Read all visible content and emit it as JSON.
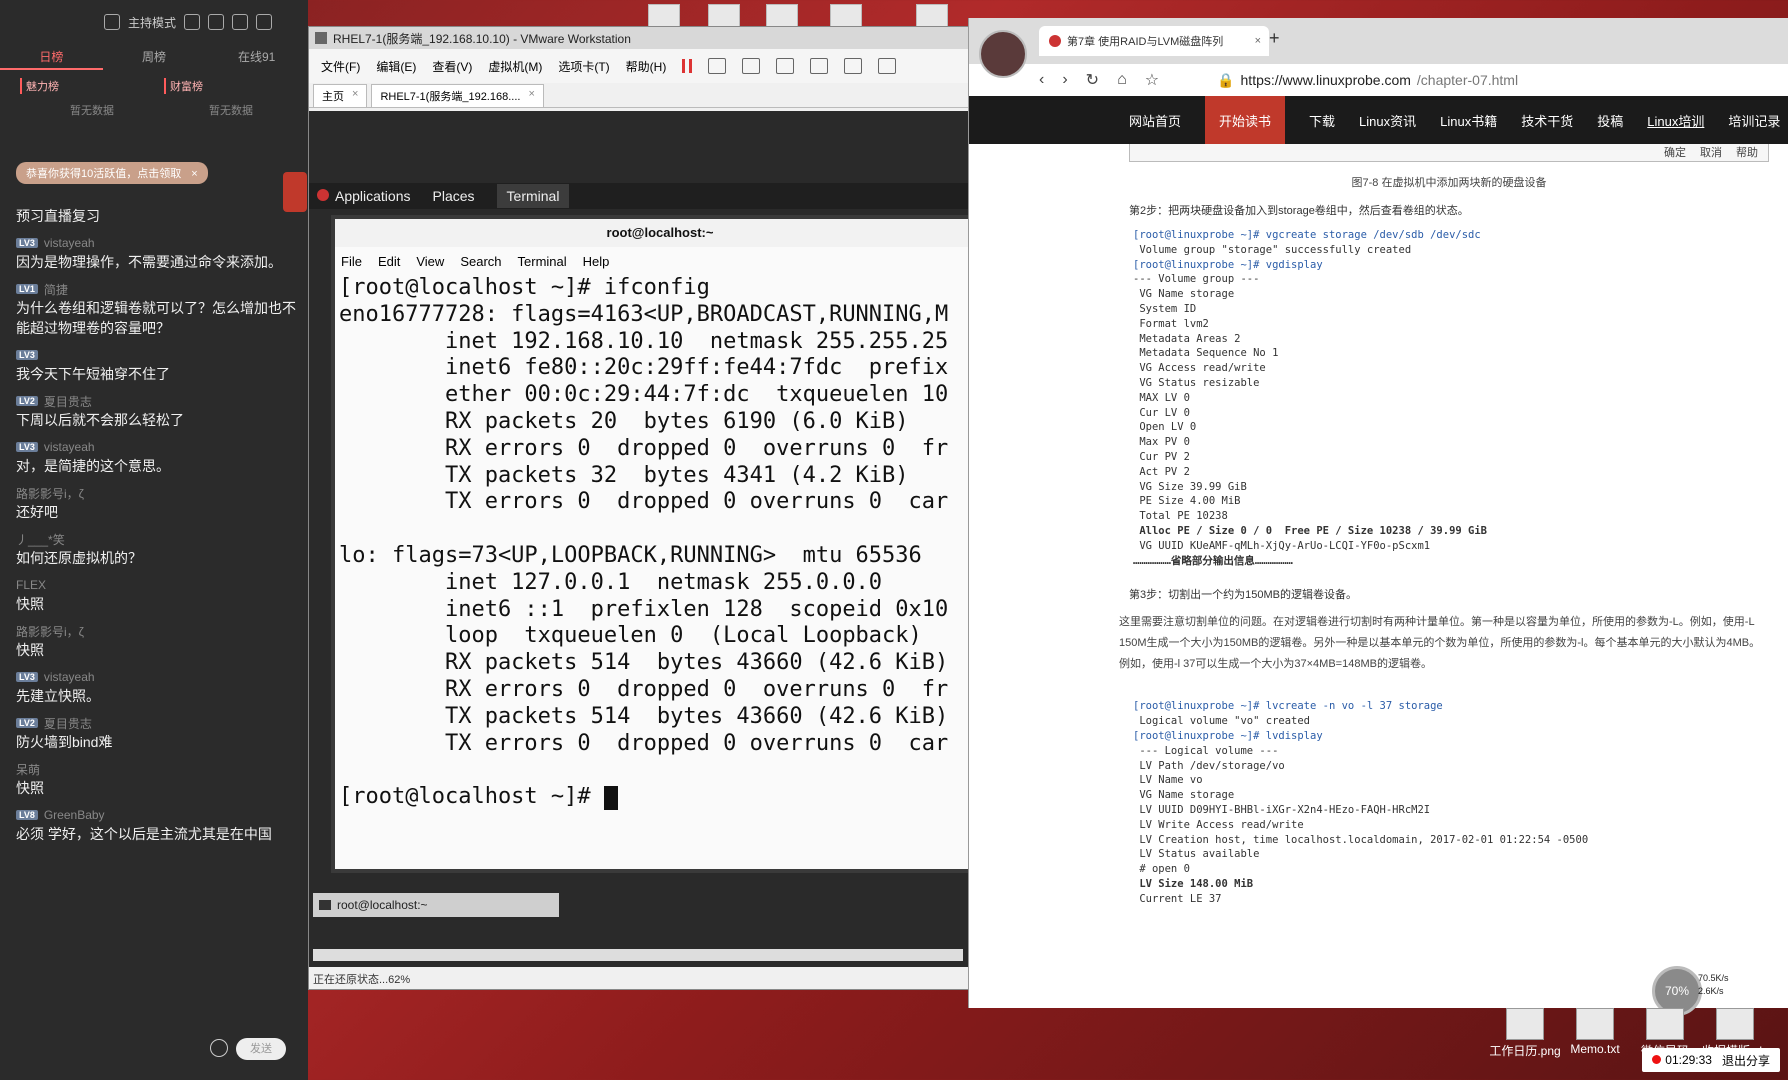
{
  "chat": {
    "mode_label": "主持模式",
    "tabs": [
      "日榜",
      "周榜",
      "在线91"
    ],
    "rank_left": "魅力榜",
    "rank_right": "财富榜",
    "no_data_left": "暂无数据",
    "no_data_right": "暂无数据",
    "banner": "恭喜你获得10活跃值，点击领取",
    "first_line": "预习直播复习",
    "messages": [
      {
        "level": "LV3",
        "user": "vistayeah",
        "text": "因为是物理操作，不需要通过命令来添加。"
      },
      {
        "level": "LV1",
        "user": "简捷",
        "text": "为什么卷组和逻辑卷就可以了？怎么增加也不能超过物理卷的容量吧？"
      },
      {
        "level": "LV3",
        "user": "",
        "text": "我今天下午短袖穿不住了"
      },
      {
        "level": "LV2",
        "user": "夏目贵志",
        "text": "下周以后就不会那么轻松了"
      },
      {
        "level": "LV3",
        "user": "vistayeah",
        "text": "对，是简捷的这个意思。"
      },
      {
        "level": "",
        "user": "路影影号i，ζ",
        "text": "还好吧"
      },
      {
        "level": "",
        "user": "丿___*笑",
        "text": "如何还原虚拟机的？"
      },
      {
        "level": "",
        "user": "FLEX",
        "text": "快照"
      },
      {
        "level": "",
        "user": "路影影号i，ζ",
        "text": "快照"
      },
      {
        "level": "LV3",
        "user": "vistayeah",
        "text": "先建立快照。"
      },
      {
        "level": "LV2",
        "user": "夏目贵志",
        "text": "防火墙到bind难"
      },
      {
        "level": "",
        "user": "呆萌",
        "text": "快照"
      },
      {
        "level": "LV8",
        "user": "GreenBaby",
        "text": "必须 学好，这个以后是主流尤其是在中国"
      }
    ],
    "send_label": "发送"
  },
  "vmware": {
    "title": "RHEL7-1(服务端_192.168.10.10) - VMware Workstation",
    "menu": [
      "文件(F)",
      "编辑(E)",
      "查看(V)",
      "虚拟机(M)",
      "选项卡(T)",
      "帮助(H)"
    ],
    "tabs": [
      {
        "label": "主页"
      },
      {
        "label": "RHEL7-1(服务端_192.168...."
      }
    ],
    "guest_panel": [
      "Applications",
      "Places",
      "Terminal"
    ],
    "terminal_title": "root@localhost:~",
    "terminal_menu": [
      "File",
      "Edit",
      "View",
      "Search",
      "Terminal",
      "Help"
    ],
    "terminal_lines": [
      "[root@localhost ~]# ifconfig",
      "eno16777728: flags=4163<UP,BROADCAST,RUNNING,M",
      "        inet 192.168.10.10  netmask 255.255.25",
      "        inet6 fe80::20c:29ff:fe44:7fdc  prefix",
      "        ether 00:0c:29:44:7f:dc  txqueuelen 10",
      "        RX packets 20  bytes 6190 (6.0 KiB)",
      "        RX errors 0  dropped 0  overruns 0  fr",
      "        TX packets 32  bytes 4341 (4.2 KiB)",
      "        TX errors 0  dropped 0 overruns 0  car",
      "",
      "lo: flags=73<UP,LOOPBACK,RUNNING>  mtu 65536",
      "        inet 127.0.0.1  netmask 255.0.0.0",
      "        inet6 ::1  prefixlen 128  scopeid 0x10",
      "        loop  txqueuelen 0  (Local Loopback)",
      "        RX packets 514  bytes 43660 (42.6 KiB)",
      "        RX errors 0  dropped 0  overruns 0  fr",
      "        TX packets 514  bytes 43660 (42.6 KiB)",
      "        TX errors 0  dropped 0 overruns 0  car",
      "",
      "[root@localhost ~]# "
    ],
    "guest_taskbar_item": "root@localhost:~",
    "status": "正在还原状态...62%"
  },
  "browser": {
    "tab_title": "第7章 使用RAID与LVM磁盘阵列",
    "url_host": "https://www.linuxprobe.com",
    "url_path": "/chapter-07.html",
    "site_nav": [
      "网站首页",
      "开始读书",
      "下载",
      "Linux资讯",
      "Linux书籍",
      "技术干货",
      "投稿",
      "Linux培训",
      "培训记录"
    ],
    "figure_buttons": [
      "确定",
      "取消",
      "帮助"
    ],
    "figure_caption": "图7-8  在虚拟机中添加两块新的硬盘设备",
    "step2": "第2步：把两块硬盘设备加入到storage卷组中，然后查看卷组的状态。",
    "code1": [
      "[root@linuxprobe ~]# vgcreate storage /dev/sdb /dev/sdc",
      " Volume group \"storage\" successfully created",
      "[root@linuxprobe ~]# vgdisplay",
      "--- Volume group ---",
      " VG Name storage",
      " System ID",
      " Format lvm2",
      " Metadata Areas 2",
      " Metadata Sequence No 1",
      " VG Access read/write",
      " VG Status resizable",
      " MAX LV 0",
      " Cur LV 0",
      " Open LV 0",
      " Max PV 0",
      " Cur PV 2",
      " Act PV 2",
      " VG Size 39.99 GiB",
      " PE Size 4.00 MiB",
      " Total PE 10238",
      " Alloc PE / Size 0 / 0  Free PE / Size 10238 / 39.99 GiB",
      " VG UUID KUeAMF-qMLh-XjQy-ArUo-LCQI-YF0o-pScxm1",
      "………………省略部分输出信息………………"
    ],
    "step3": "第3步：切割出一个约为150MB的逻辑卷设备。",
    "para": "这里需要注意切割单位的问题。在对逻辑卷进行切割时有两种计量单位。第一种是以容量为单位，所使用的参数为-L。例如，使用-L 150M生成一个大小为150MB的逻辑卷。另外一种是以基本单元的个数为单位，所使用的参数为-l。每个基本单元的大小默认为4MB。例如，使用-l 37可以生成一个大小为37×4MB=148MB的逻辑卷。",
    "code2": [
      "[root@linuxprobe ~]# lvcreate -n vo -l 37 storage",
      " Logical volume \"vo\" created",
      "[root@linuxprobe ~]# lvdisplay",
      " --- Logical volume ---",
      " LV Path /dev/storage/vo",
      " LV Name vo",
      " VG Name storage",
      " LV UUID D09HYI-BHBl-iXGr-X2n4-HEzo-FAQH-HRcM2I",
      " LV Write Access read/write",
      " LV Creation host, time localhost.localdomain, 2017-02-01 01:22:54 -0500",
      " LV Status available",
      " # open 0",
      " LV Size 148.00 MiB",
      " Current LE 37"
    ]
  },
  "desktop": {
    "progress": "70%",
    "net_up": "70.5K/s",
    "net_down": "2.6K/s",
    "icons": [
      {
        "label": "工作日历.png"
      },
      {
        "label": "Memo.txt"
      },
      {
        "label": "微信导码"
      },
      {
        "label": "收据模版.xls"
      }
    ],
    "timer": "01:29:33",
    "exit_share": "退出分享"
  }
}
